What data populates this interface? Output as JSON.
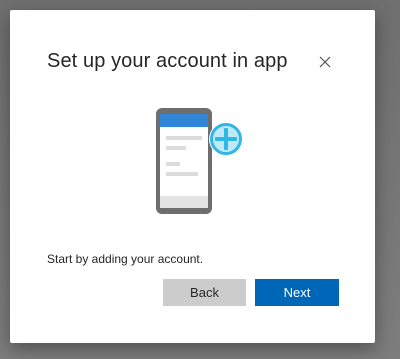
{
  "dialog": {
    "title": "Set up your account in app",
    "message": "Start by adding your account.",
    "close_icon": "close-icon",
    "illustration": "phone-add-account-illustration"
  },
  "buttons": {
    "back_label": "Back",
    "next_label": "Next"
  },
  "colors": {
    "primary": "#0067b8",
    "secondary_button": "#cccccc",
    "accent_plus": "#2fb7e6",
    "phone_frame": "#6e6e6e"
  }
}
